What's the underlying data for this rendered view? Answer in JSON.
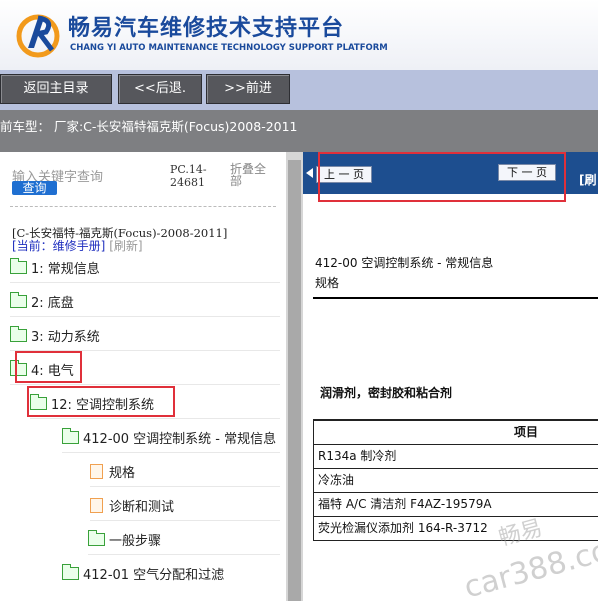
{
  "header": {
    "title_cn": "畅易汽车维修技术支持平台",
    "title_en": "CHANG YI AUTO MAINTENANCE TECHNOLOGY SUPPORT PLATFORM"
  },
  "nav": {
    "home": "返回主目录",
    "back": "<<后退.",
    "forward": ">>前进"
  },
  "model_bar": {
    "text": "前车型：  厂家:C-长安福特福克斯(Focus)2008-2011"
  },
  "search": {
    "placeholder": "输入关键字查询",
    "button": "查询",
    "pc_line1": "PC.14-",
    "pc_line2": "24681",
    "collapse": "折叠全部"
  },
  "path": {
    "text": "[C-长安福特-福克斯(Focus)-2008-2011]",
    "current_label": "[当前：维修手册]",
    "refresh": "[刷新]"
  },
  "tree": [
    {
      "label": "1: 常规信息",
      "type": "folder"
    },
    {
      "label": "2: 底盘",
      "type": "folder"
    },
    {
      "label": "3: 动力系统",
      "type": "folder"
    },
    {
      "label": "4: 电气",
      "type": "folder"
    },
    {
      "label": "12: 空调控制系统",
      "type": "folder"
    },
    {
      "label": "412-00 空调控制系统 - 常规信息",
      "type": "folder"
    },
    {
      "label": "规格",
      "type": "doc"
    },
    {
      "label": "诊断和测试",
      "type": "doc"
    },
    {
      "label": "一般步骤",
      "type": "folder"
    },
    {
      "label": "412-01 空气分配和过滤",
      "type": "folder"
    }
  ],
  "pager": {
    "prev": "上 一 页",
    "next": "下 一 页",
    "refresh": "[刷"
  },
  "document": {
    "title": "412-00 空调控制系统 - 常规信息",
    "subtitle": "规格",
    "section": "润滑剂，密封胶和粘合剂",
    "table_header": "项目",
    "rows": [
      "R134a 制冷剂",
      "冷冻油",
      "福特 A/C 清洁剂 F4AZ-19579A",
      "荧光检漏仪添加剂 164-R-3712"
    ]
  },
  "watermark": {
    "line1": "畅易",
    "line2": "car388.com"
  },
  "colors": {
    "brand": "#1a4a9c",
    "accent_blue": "#1d4e8f",
    "highlight_red": "#e0303a",
    "tree_green": "#39a13a"
  }
}
